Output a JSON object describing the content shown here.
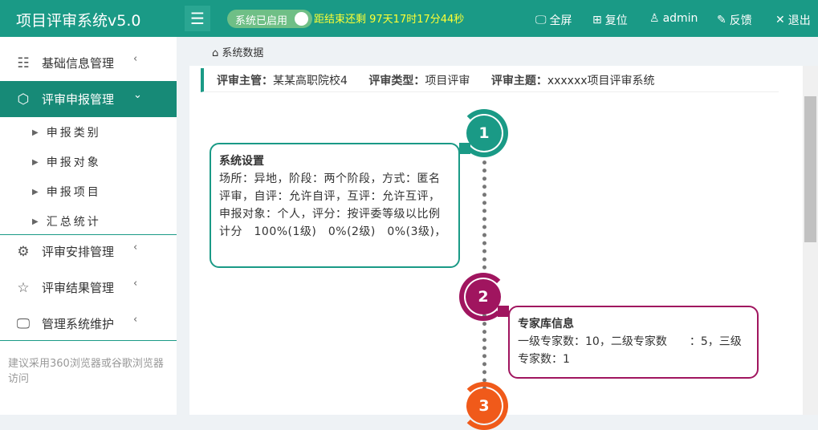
{
  "header": {
    "title": "项目评审系统v5.0",
    "toggle_label": "系统已启用",
    "countdown": "距结束还剩 97天17时17分44秒",
    "nav": [
      {
        "icon": "monitor-icon",
        "glyph": "🖵",
        "label": "全屏"
      },
      {
        "icon": "grid-icon",
        "glyph": "⊞",
        "label": "复位"
      },
      {
        "icon": "user-icon",
        "glyph": "♙",
        "label": "admin"
      },
      {
        "icon": "feedback-icon",
        "glyph": "✎",
        "label": "反馈"
      },
      {
        "icon": "close-icon",
        "glyph": "✕",
        "label": "退出"
      }
    ]
  },
  "sidebar": {
    "items": [
      {
        "label": "基础信息管理",
        "chev": "‹"
      },
      {
        "label": "评审申报管理",
        "chev": "⌄"
      },
      {
        "label": "评审安排管理",
        "chev": "‹"
      },
      {
        "label": "评审结果管理",
        "chev": "‹"
      },
      {
        "label": "管理系统维护",
        "chev": "‹"
      }
    ],
    "subitems": [
      "申报类别",
      "申报对象",
      "申报项目",
      "汇总统计"
    ],
    "tip": "建议采用360浏览器或谷歌浏览器访问"
  },
  "breadcrumb": "系统数据",
  "info": {
    "supervisor_label": "评审主管：",
    "supervisor": "某某高职院校4",
    "type_label": "评审类型：",
    "type": "项目评审",
    "theme_label": "评审主题：",
    "theme": "xxxxxx项目评审系统"
  },
  "timeline": [
    {
      "num": "1",
      "title": "系统设置",
      "text": "场所：异地，阶段：两个阶段，方式：匿名评审，自评：允许自评，互评：允许互评，申报对象：个人，评分：按评委等级以比例计分　100%(1级)　0%(2级)　0%(3级)，",
      "color": "#1a9a86"
    },
    {
      "num": "2",
      "title": "专家库信息",
      "text": "一级专家数：10，二级专家数　　：5，三级专家数：1",
      "color": "#a0155f"
    },
    {
      "num": "3",
      "color": "#f05a1a"
    }
  ]
}
